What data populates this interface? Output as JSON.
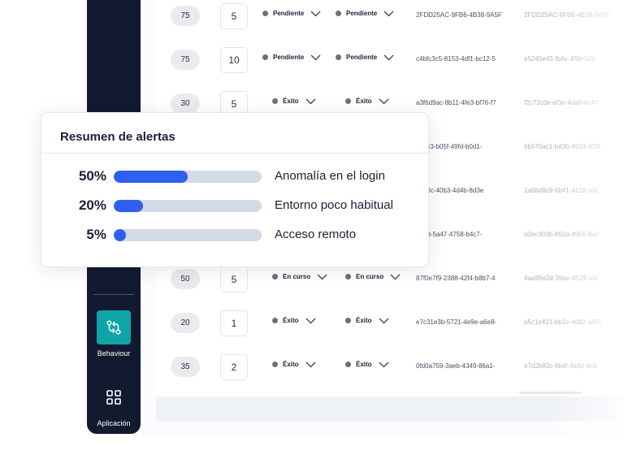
{
  "sidebar": {
    "items": [
      {
        "label": "Behaviour",
        "icon": "git-compare-icon",
        "active": true
      },
      {
        "label": "Aplicación",
        "icon": "grid-icon",
        "active": false
      }
    ]
  },
  "table": {
    "rows": [
      {
        "score": "75",
        "count": "5",
        "status1": "Pendiente",
        "status2": "Pendiente",
        "id1": "2FDD25AC-9FB6-4B38-9A5F",
        "id2": "2FDD25AC-9FB6-4B38-9A5F"
      },
      {
        "score": "75",
        "count": "10",
        "status1": "Pendiente",
        "status2": "Pendiente",
        "id1": "c4bfc3c5-8153-4df1-bc12-5",
        "id2": "e5245e43-fb4e-4f9b-b0c"
      },
      {
        "score": "30",
        "count": "5",
        "status1": "Éxito",
        "status2": "Éxito",
        "id1": "a3f6d9ac-8b11-4fe3-bf76-f7",
        "id2": "f2c72c0e-ef3e-4da6-bc47"
      },
      {
        "score": "",
        "count": "",
        "status1": "",
        "status2": "",
        "id1": "c9643-b05f-49fd-b0d1-",
        "id2": "6b570ac1-bd36-4934-97f4"
      },
      {
        "score": "",
        "count": "",
        "status1": "",
        "status2": "",
        "id1": "43a3c-40b3-4d4b-8d3e",
        "id2": "1a6bd8c9-6b41-4128-adc"
      },
      {
        "score": "",
        "count": "",
        "status1": "",
        "status2": "",
        "id1": "662d-5a47-4758-b4c7-",
        "id2": "d2ec303b-862a-49b6-8a0"
      },
      {
        "score": "50",
        "count": "5",
        "status1": "En curso",
        "status2": "En curso",
        "id1": "87f0e7f9-2388-42f4-b8b7-4",
        "id2": "9aa99e2d-39ae-4529-a0c"
      },
      {
        "score": "20",
        "count": "1",
        "status1": "Éxito",
        "status2": "Éxito",
        "id1": "e7c31e3b-5721-4e9e-a6e8-",
        "id2": "b5c1e421-bb1e-4d82-a6f0"
      },
      {
        "score": "35",
        "count": "2",
        "status1": "Éxito",
        "status2": "Éxito",
        "id1": "0fd0a759-3aeb-4349-86a1-",
        "id2": "e7d2b92c-8b4f-4a9d-9cb"
      }
    ]
  },
  "alerts_card": {
    "title": "Resumen de alertas",
    "items": [
      {
        "percent_label": "50%",
        "value": 0.5,
        "label": "Anomalía en el login"
      },
      {
        "percent_label": "20%",
        "value": 0.2,
        "label": "Entorno poco habitual"
      },
      {
        "percent_label": "5%",
        "value": 0.05,
        "label": "Acceso remoto"
      }
    ]
  },
  "colors": {
    "sidebar_bg": "#121a2f",
    "accent_teal": "#0ea5a8",
    "bar_fill": "#2f5ef0",
    "bar_track": "#d4d9e6"
  }
}
